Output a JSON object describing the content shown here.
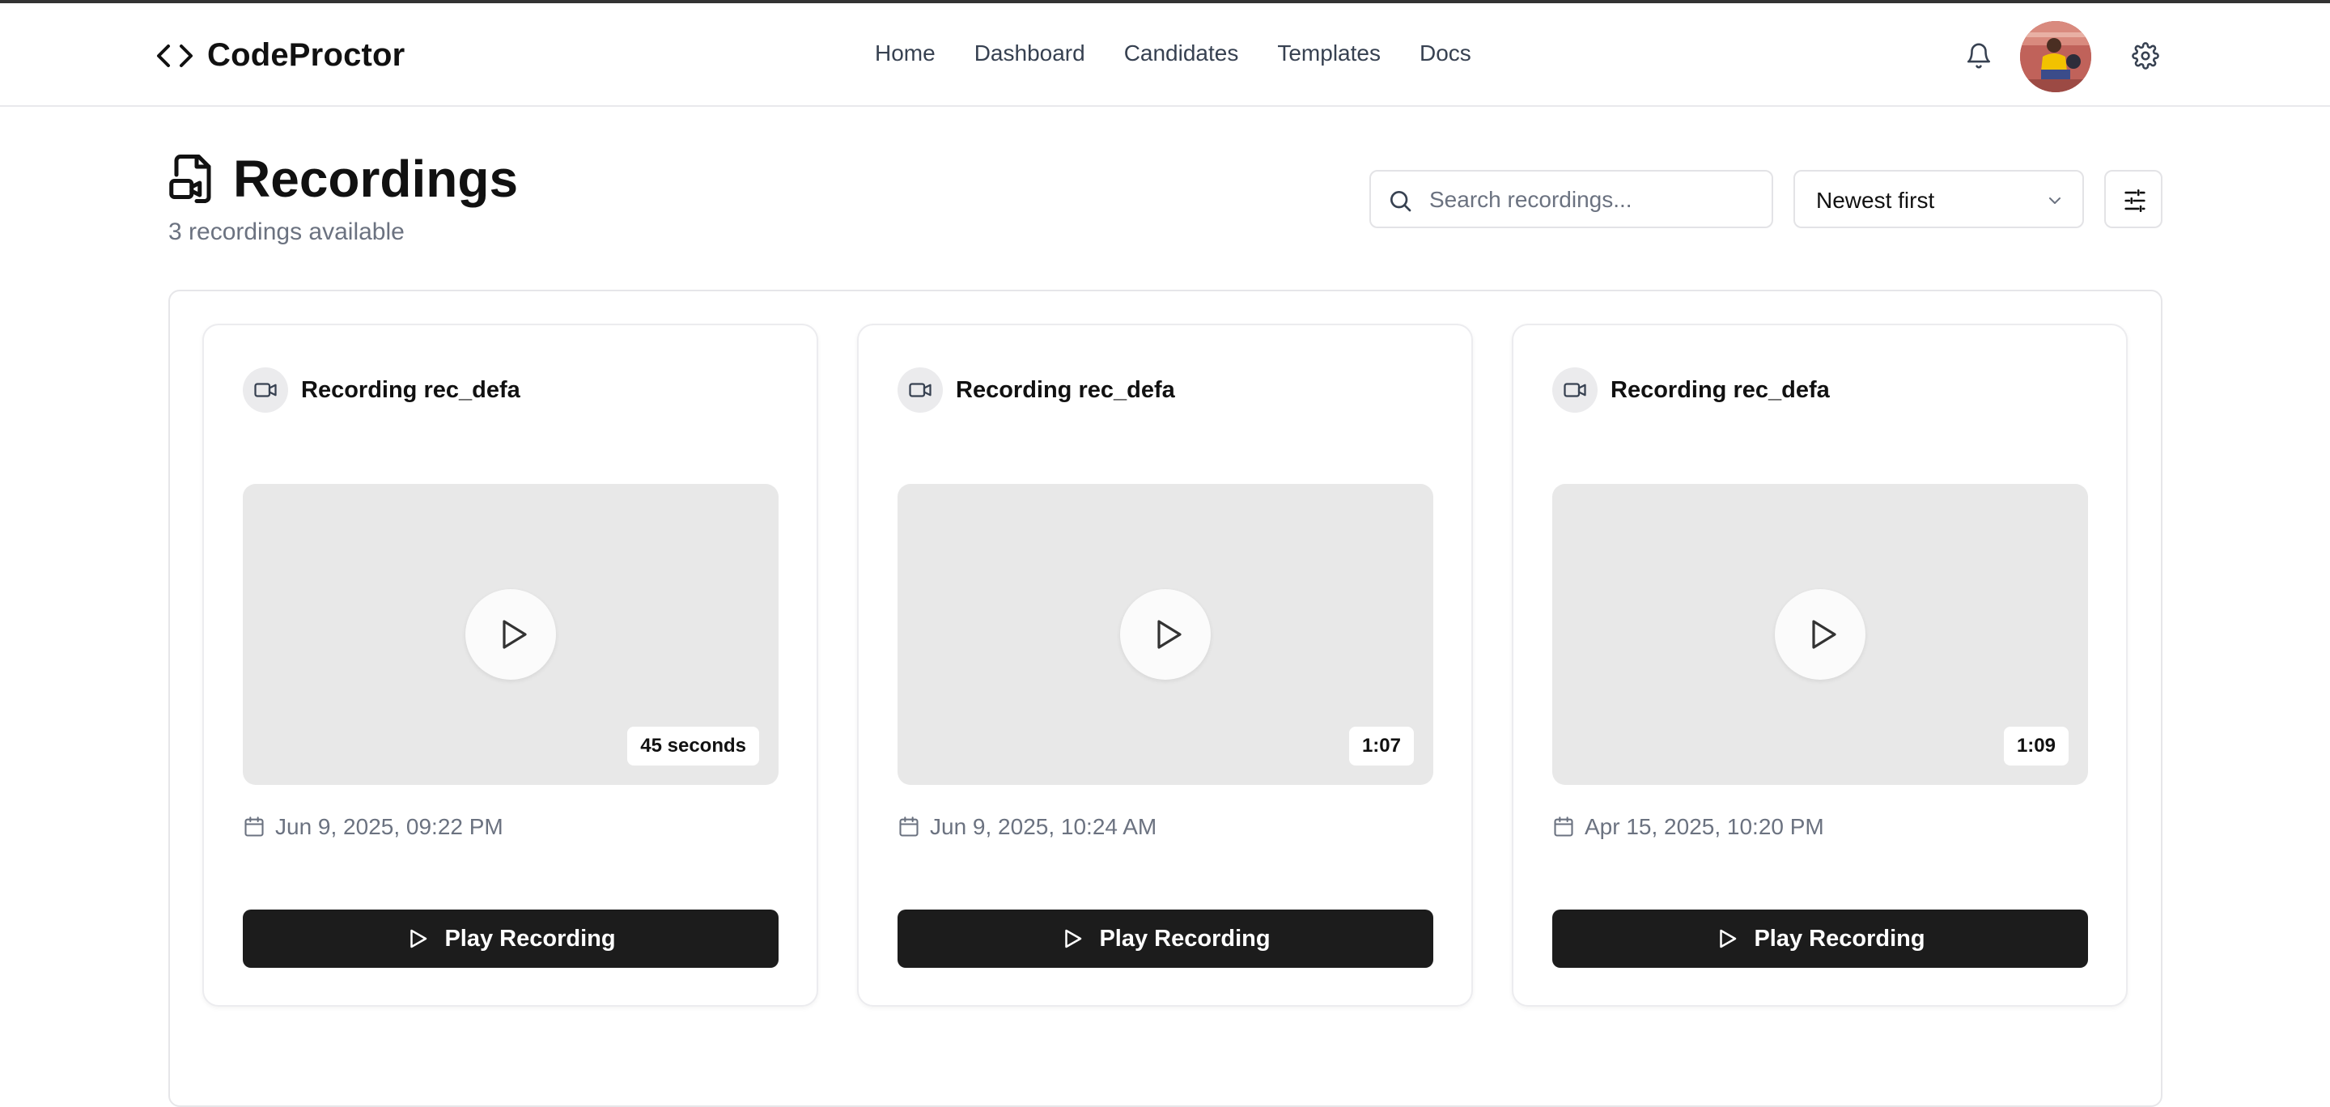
{
  "header": {
    "brand": "CodeProctor",
    "nav": [
      "Home",
      "Dashboard",
      "Candidates",
      "Templates",
      "Docs"
    ]
  },
  "page": {
    "title": "Recordings",
    "subtitle": "3 recordings available"
  },
  "toolbar": {
    "search_placeholder": "Search recordings...",
    "sort_value": "Newest first"
  },
  "recordings": [
    {
      "title": "Recording rec_defa",
      "duration": "45 seconds",
      "date": "Jun 9, 2025, 09:22 PM",
      "button": "Play Recording"
    },
    {
      "title": "Recording rec_defa",
      "duration": "1:07",
      "date": "Jun 9, 2025, 10:24 AM",
      "button": "Play Recording"
    },
    {
      "title": "Recording rec_defa",
      "duration": "1:09",
      "date": "Apr 15, 2025, 10:20 PM",
      "button": "Play Recording"
    }
  ],
  "icons": {
    "logo": "code-brackets-icon",
    "notifications": "bell-icon",
    "settings": "gear-icon",
    "page": "file-video-icon",
    "search": "search-icon",
    "sort": "chevron-down-icon",
    "filter": "sliders-icon",
    "card": "video-camera-icon",
    "date": "calendar-icon",
    "play": "play-icon"
  },
  "colors": {
    "primary_button": "#1c1c1c",
    "thumbnail": "#e8e8e8",
    "muted_text": "#6b7280"
  }
}
